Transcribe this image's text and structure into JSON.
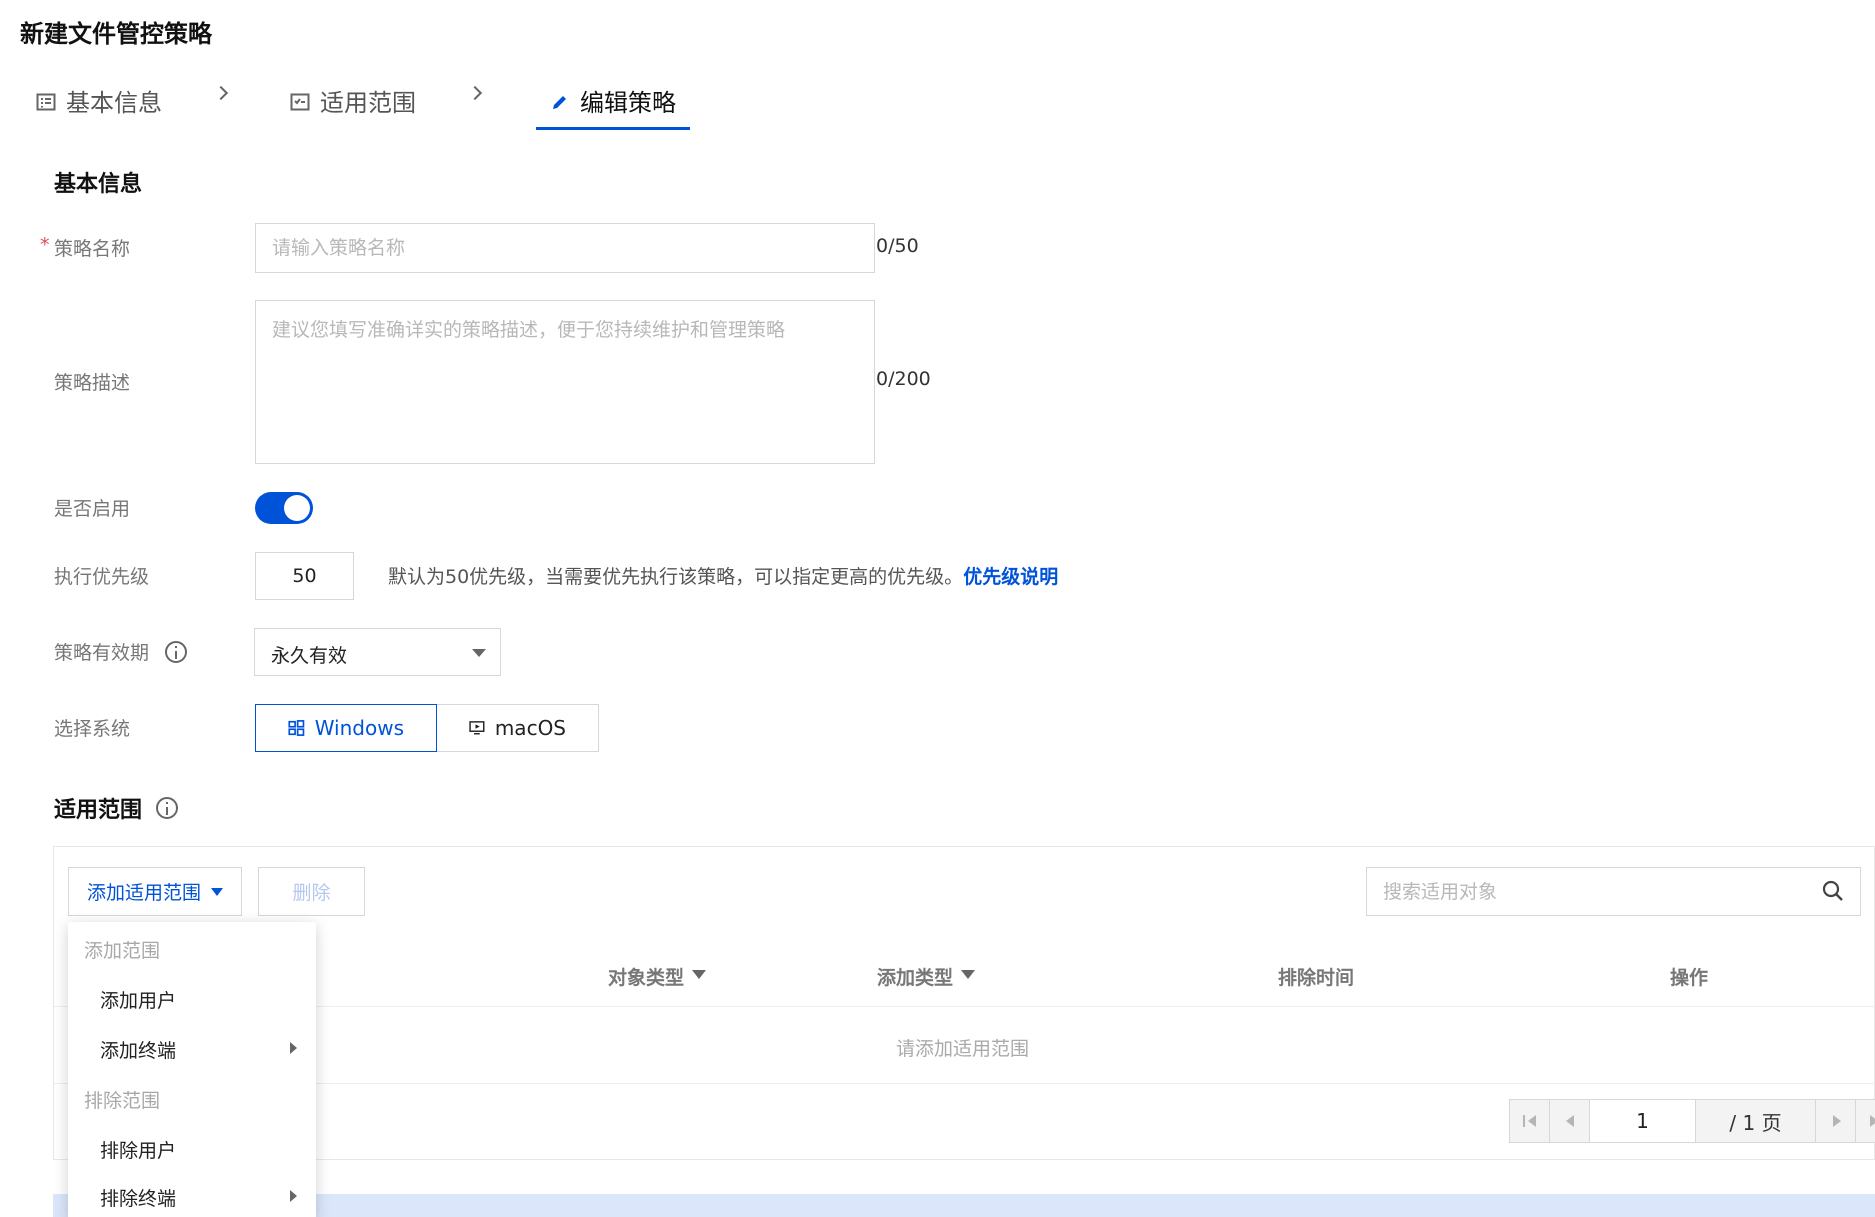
{
  "page": {
    "title": "新建文件管控策略"
  },
  "steps": [
    {
      "label": "基本信息",
      "icon": "list-icon",
      "active": false
    },
    {
      "label": "适用范围",
      "icon": "checklist-icon",
      "active": false
    },
    {
      "label": "编辑策略",
      "icon": "pencil-icon",
      "active": true
    }
  ],
  "basic_info": {
    "section_title": "基本信息",
    "name": {
      "label": "策略名称",
      "required_mark": "*",
      "placeholder": "请输入策略名称",
      "value": "",
      "counter": "0/50"
    },
    "description": {
      "label": "策略描述",
      "placeholder": "建议您填写准确详实的策略描述，便于您持续维护和管理策略",
      "value": "",
      "counter": "0/200"
    },
    "enabled": {
      "label": "是否启用",
      "value": true
    },
    "priority": {
      "label": "执行优先级",
      "value": "50",
      "hint": "默认为50优先级，当需要优先执行该策略，可以指定更高的优先级。",
      "hint_link": "优先级说明"
    },
    "validity": {
      "label": "策略有效期",
      "value": "永久有效"
    },
    "os": {
      "label": "选择系统",
      "options": [
        "Windows",
        "macOS"
      ],
      "selected": "Windows"
    }
  },
  "scope": {
    "section_title": "适用范围",
    "add_button": "添加适用范围",
    "delete_button": "删除",
    "search_placeholder": "搜索适用对象",
    "columns": [
      "对象类型",
      "添加类型",
      "排除时间",
      "操作"
    ],
    "empty_text": "请添加适用范围",
    "pagination": {
      "current": "1",
      "total": "/ 1 页"
    },
    "dropdown": {
      "group_add": "添加范围",
      "add_user": "添加用户",
      "add_terminal": "添加终端",
      "group_exclude": "排除范围",
      "exclude_user": "排除用户",
      "exclude_terminal": "排除终端"
    }
  },
  "colors": {
    "primary": "#0052d9",
    "required": "#e34d59"
  }
}
